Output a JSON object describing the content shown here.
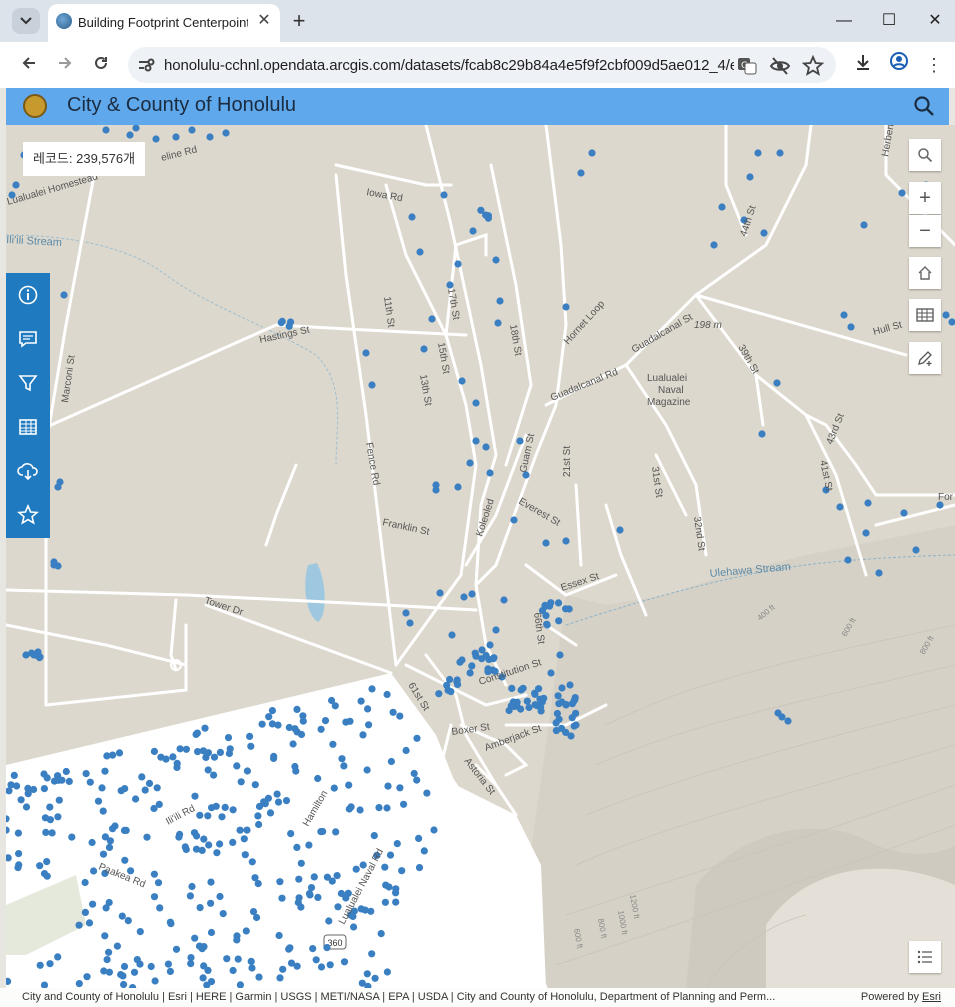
{
  "browser": {
    "tab_title": "Building Footprint Centerpoint",
    "url": "honolulu-cchnl.opendata.arcgis.com/datasets/fcab8c29b84a4e5f9f2cbf009d5ae012_4/e...",
    "icons": [
      "tab-search-icon",
      "favicon-icon",
      "close-icon",
      "plus-icon",
      "minimize-icon",
      "maximize-icon",
      "close-window-icon",
      "back-icon",
      "forward-icon",
      "reload-icon",
      "site-info-icon",
      "translate-icon",
      "eye-off-icon",
      "star-icon",
      "download-icon",
      "profile-icon",
      "more-icon"
    ]
  },
  "app": {
    "title": "City & County of Honolulu"
  },
  "map": {
    "record_count": "레코드: 239,576개",
    "labels": {
      "jowa": "Iowa Rd",
      "hastings": "Hastings St",
      "marconi": "Marconi St",
      "eleventh": "11th St",
      "seventeenth": "17th St",
      "eighteenth": "18th St",
      "fifteenth": "15th St",
      "thirteenth": "13th St",
      "hornet": "Hornet Loop",
      "guadalcanal1": "Guadalcanal Rd",
      "guadalcanal2": "Guadalcanal St",
      "fortyfourth": "44th St",
      "hull": "Hull St",
      "elev198": "198 m",
      "thirtyninth": "39th St",
      "lualualei_naval_1": "Lualualei",
      "lualualei_naval_2": "Naval",
      "lualualei_naval_3": "Magazine",
      "fence": "Fence Rd",
      "guam": "Guam St",
      "koleoled": "Koleoled",
      "everest": "Everest St",
      "twentyfirst": "21st St",
      "thirtyfirst": "31st St",
      "thirtysecond": "32nd St",
      "fortythird": "43rd St",
      "fortyfirst": "41st St",
      "franklin": "Franklin St",
      "tower": "Tower Dr",
      "essex": "Essex St",
      "sixtysixth": "66th St",
      "ulehawa": "Ulehawa Stream",
      "constitution": "Constitution St",
      "sixtyfirst": "61st St",
      "boxer": "Boxer St",
      "amberjack": "Amberjack St",
      "astoria": "Astoria St",
      "iliili_rd": "Ili'ili Rd",
      "hamilton": "Hamilton",
      "paakea": "Paakea Rd",
      "lualualei_naval_rd": "Lualualei Naval Rd",
      "route360": "360",
      "iliili_stream": "Ili'ili Stream",
      "homestead": "Lualualei Homestead",
      "line_rd": "eline Rd",
      "hefter": "Herbert",
      "for": "For",
      "ft400": "400 ft",
      "ft600a": "600 ft",
      "ft800a": "800 ft",
      "ft600b": "600 ft",
      "ft800b": "800 ft",
      "ft1000": "1000 ft",
      "ft1200": "1200 ft"
    },
    "side_icons": [
      "info-icon",
      "comment-icon",
      "filter-icon",
      "table-icon",
      "cloud-download-icon",
      "star-icon"
    ],
    "control_icons": [
      "search-icon",
      "zoom-in-icon",
      "zoom-out-icon",
      "home-icon",
      "table-icon",
      "sketch-icon",
      "legend-icon"
    ],
    "zoom_in": "+",
    "zoom_out": "−",
    "point_color": "#3a7fc1"
  },
  "attribution": {
    "text": "City and County of Honolulu | Esri | HERE | Garmin | USGS | METI/NASA | EPA | USDA | City and County of Honolulu, Department of Planning and Perm...",
    "powered_by": "Powered by",
    "esri": "Esri"
  }
}
